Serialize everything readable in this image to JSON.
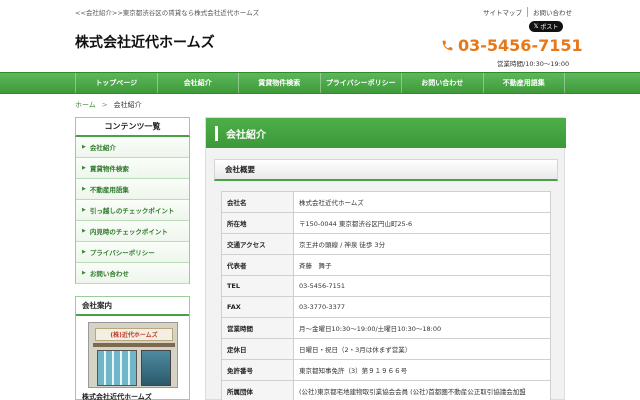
{
  "header": {
    "tagline": "<<会社紹介>>東京都渋谷区の賃貸なら株式会社近代ホームズ",
    "site_title": "株式会社近代ホームズ",
    "top_links": [
      "サイトマップ",
      "お問い合わせ"
    ],
    "share_label": "ポスト",
    "share_icon": "x-logo-icon",
    "phone_icon": "phone-icon",
    "phone": "03-5456-7151",
    "hours": "営業時間/10:30〜19:00",
    "accent_color": "#e87718"
  },
  "nav": {
    "items": [
      "トップページ",
      "会社紹介",
      "賃貸物件検索",
      "プライバシーポリシー",
      "お問い合わせ",
      "不動産用語集"
    ],
    "color": "#4aa046"
  },
  "breadcrumb": {
    "home": "ホーム",
    "separator": ">",
    "current": "会社紹介"
  },
  "sidebar": {
    "title": "コンテンツ一覧",
    "items": [
      "会社紹介",
      "賃貸物件検索",
      "不動産用語集",
      "引っ越しのチェックポイント",
      "内見時のチェックポイント",
      "プライバシーポリシー",
      "お問い合わせ"
    ],
    "company_box_title": "会社案内",
    "store_sign": "(株)近代ホームズ",
    "company_caption": "株式会社近代ホームズ"
  },
  "main": {
    "title": "会社紹介",
    "section_title": "会社概要",
    "rows": [
      {
        "label": "会社名",
        "value": "株式会社近代ホームズ"
      },
      {
        "label": "所在地",
        "value": "〒150-0044 東京都渋谷区円山町25-6"
      },
      {
        "label": "交通アクセス",
        "value": "京王井の頭線 / 神泉 徒歩 3分"
      },
      {
        "label": "代表者",
        "value": "斉藤　舞子"
      },
      {
        "label": "TEL",
        "value": "03-5456-7151"
      },
      {
        "label": "FAX",
        "value": "03-3770-3377"
      },
      {
        "label": "営業時間",
        "value": "月〜金曜日10:30〜19:00/土曜日10:30〜18:00"
      },
      {
        "label": "定休日",
        "value": "日曜日・祝日（2・3月は休まず営業）"
      },
      {
        "label": "免許番号",
        "value": "東京都知事免許（3）第９１９６６号"
      },
      {
        "label": "所属団体",
        "value": "(公社)東京都宅地建物取引業協会会員 (公社)首都圏不動産公正取引協議会加盟"
      }
    ]
  }
}
